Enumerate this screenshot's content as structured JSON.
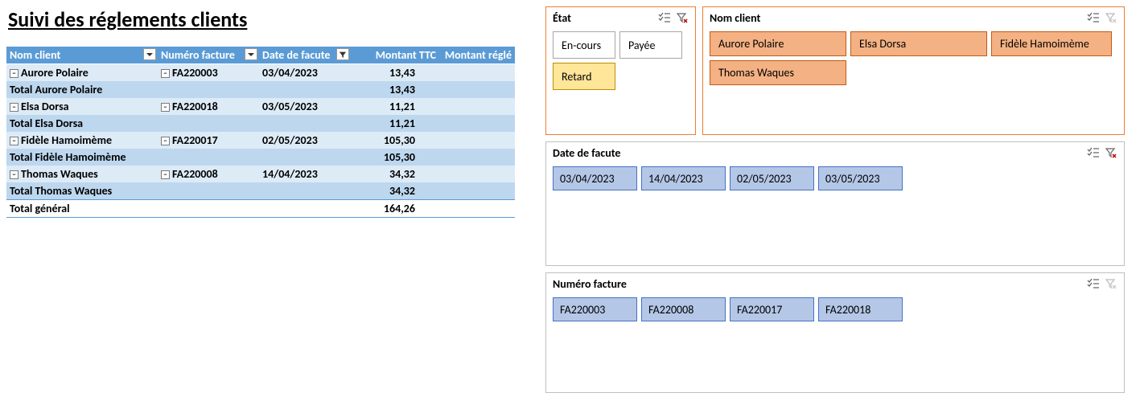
{
  "title": "Suivi des réglements clients",
  "pivot": {
    "headers": {
      "nom_client": "Nom client",
      "numero_facture": "Numéro facture",
      "date_facture": "Date de facute",
      "montant_ttc": "Montant TTC",
      "montant_regle": "Montant réglé"
    },
    "groups": [
      {
        "client": "Aurore Polaire",
        "facture": "FA220003",
        "date": "03/04/2023",
        "montant": "13,43",
        "total_label": "Total Aurore Polaire",
        "total": "13,43"
      },
      {
        "client": "Elsa Dorsa",
        "facture": "FA220018",
        "date": "03/05/2023",
        "montant": "11,21",
        "total_label": "Total Elsa Dorsa",
        "total": "11,21"
      },
      {
        "client": "Fidèle Hamoimème",
        "facture": "FA220017",
        "date": "02/05/2023",
        "montant": "105,30",
        "total_label": "Total Fidèle Hamoimème",
        "total": "105,30"
      },
      {
        "client": "Thomas Waques",
        "facture": "FA220008",
        "date": "14/04/2023",
        "montant": "34,32",
        "total_label": "Total Thomas Waques",
        "total": "34,32"
      }
    ],
    "grand_total_label": "Total général",
    "grand_total": "164,26"
  },
  "slicers": {
    "etat": {
      "title": "État",
      "items": [
        "En-cours",
        "Payée",
        "Retard"
      ],
      "selected": "Retard"
    },
    "nom": {
      "title": "Nom client",
      "items": [
        "Aurore Polaire",
        "Elsa Dorsa",
        "Fidèle Hamoimème",
        "Thomas Waques"
      ]
    },
    "date": {
      "title": "Date de facute",
      "items": [
        "03/04/2023",
        "14/04/2023",
        "02/05/2023",
        "03/05/2023"
      ]
    },
    "numero": {
      "title": "Numéro facture",
      "items": [
        "FA220003",
        "FA220008",
        "FA220017",
        "FA220018"
      ]
    }
  }
}
